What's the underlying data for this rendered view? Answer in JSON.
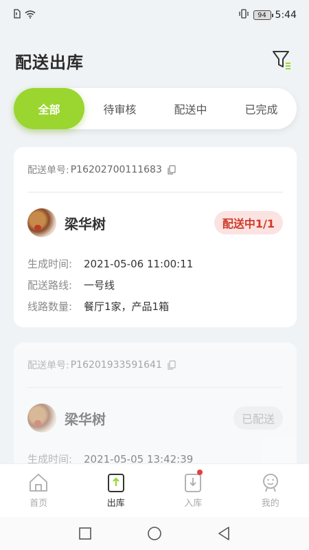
{
  "status_bar": {
    "time": "5:44",
    "battery": "94"
  },
  "header": {
    "title": "配送出库"
  },
  "tabs": [
    {
      "label": "全部",
      "active": true
    },
    {
      "label": "待审核",
      "active": false
    },
    {
      "label": "配送中",
      "active": false
    },
    {
      "label": "已完成",
      "active": false
    }
  ],
  "orders": [
    {
      "order_label": "配送单号:",
      "order_no": "P16202700111683",
      "user_name": "梁华树",
      "status": "配送中1/1",
      "info": [
        {
          "label": "生成时间:",
          "value": "2021-05-06 11:00:11"
        },
        {
          "label": "配送路线:",
          "value": "一号线"
        },
        {
          "label": "线路数量:",
          "value": "餐厅1家，产品1箱"
        }
      ]
    },
    {
      "order_label": "配送单号:",
      "order_no": "P16201933591641",
      "user_name": "梁华树",
      "status": "已配送",
      "info": [
        {
          "label": "生成时间:",
          "value": "2021-05-05 13:42:39"
        }
      ]
    }
  ],
  "bottom_nav": [
    {
      "label": "首页",
      "icon": "home-icon"
    },
    {
      "label": "出库",
      "icon": "outbound-icon",
      "active": true
    },
    {
      "label": "入库",
      "icon": "inbound-icon",
      "badge": true
    },
    {
      "label": "我的",
      "icon": "profile-icon"
    }
  ],
  "colors": {
    "accent": "#9ad62f",
    "status_red": "#d03a2a",
    "status_red_bg": "#fbe3e1"
  }
}
